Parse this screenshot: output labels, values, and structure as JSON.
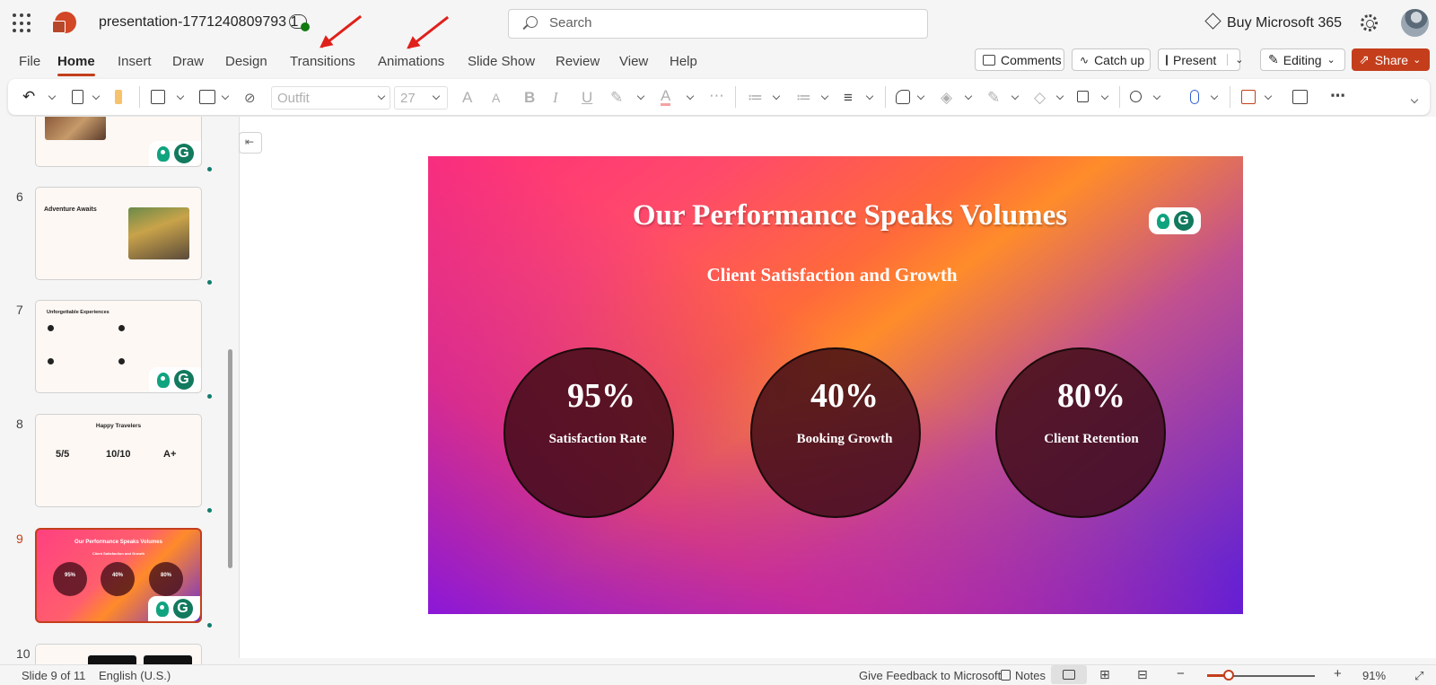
{
  "app": {
    "doc_title": "presentation-1771240809793 1",
    "search_placeholder": "Search",
    "buy_label": "Buy Microsoft 365"
  },
  "menu": {
    "tabs": [
      "File",
      "Home",
      "Insert",
      "Draw",
      "Design",
      "Transitions",
      "Animations",
      "Slide Show",
      "Review",
      "View",
      "Help"
    ],
    "active_tab": "Home",
    "comments_label": "Comments",
    "catchup_label": "Catch up",
    "present_label": "Present",
    "editing_label": "Editing",
    "share_label": "Share"
  },
  "ribbon": {
    "font_name": "Outfit",
    "font_size": "27"
  },
  "thumbnails": [
    {
      "num": "6",
      "title": "Adventure Awaits"
    },
    {
      "num": "7",
      "title": "Unforgettable Experiences"
    },
    {
      "num": "8",
      "title": "Happy Travelers",
      "stats": [
        "5/5",
        "10/10",
        "A+"
      ]
    },
    {
      "num": "9",
      "title": "Our Performance Speaks Volumes",
      "subtitle": "Client Satisfaction and Growth",
      "stats": [
        "95%",
        "40%",
        "80%"
      ]
    },
    {
      "num": "10"
    }
  ],
  "slide": {
    "title": "Our Performance Speaks Volumes",
    "subtitle": "Client Satisfaction and Growth",
    "metrics": [
      {
        "value": "95%",
        "label": "Satisfaction Rate"
      },
      {
        "value": "40%",
        "label": "Booking Growth"
      },
      {
        "value": "80%",
        "label": "Client Retention"
      }
    ]
  },
  "status": {
    "slide_info": "Slide 9 of 11",
    "language": "English (U.S.)",
    "feedback": "Give Feedback to Microsoft",
    "notes": "Notes",
    "zoom": "91%"
  }
}
